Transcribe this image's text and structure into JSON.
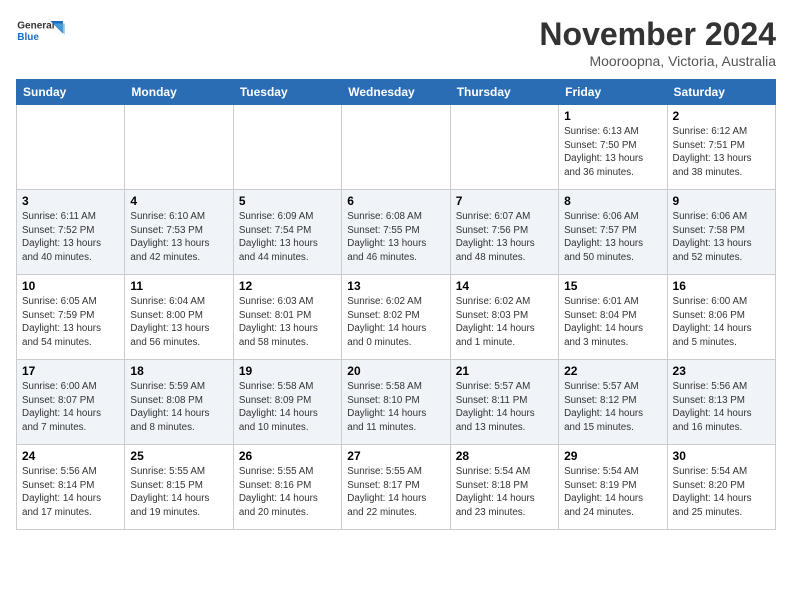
{
  "header": {
    "logo_line1": "General",
    "logo_line2": "Blue",
    "month": "November 2024",
    "location": "Mooroopna, Victoria, Australia"
  },
  "weekdays": [
    "Sunday",
    "Monday",
    "Tuesday",
    "Wednesday",
    "Thursday",
    "Friday",
    "Saturday"
  ],
  "weeks": [
    [
      {
        "day": "",
        "info": ""
      },
      {
        "day": "",
        "info": ""
      },
      {
        "day": "",
        "info": ""
      },
      {
        "day": "",
        "info": ""
      },
      {
        "day": "",
        "info": ""
      },
      {
        "day": "1",
        "info": "Sunrise: 6:13 AM\nSunset: 7:50 PM\nDaylight: 13 hours\nand 36 minutes."
      },
      {
        "day": "2",
        "info": "Sunrise: 6:12 AM\nSunset: 7:51 PM\nDaylight: 13 hours\nand 38 minutes."
      }
    ],
    [
      {
        "day": "3",
        "info": "Sunrise: 6:11 AM\nSunset: 7:52 PM\nDaylight: 13 hours\nand 40 minutes."
      },
      {
        "day": "4",
        "info": "Sunrise: 6:10 AM\nSunset: 7:53 PM\nDaylight: 13 hours\nand 42 minutes."
      },
      {
        "day": "5",
        "info": "Sunrise: 6:09 AM\nSunset: 7:54 PM\nDaylight: 13 hours\nand 44 minutes."
      },
      {
        "day": "6",
        "info": "Sunrise: 6:08 AM\nSunset: 7:55 PM\nDaylight: 13 hours\nand 46 minutes."
      },
      {
        "day": "7",
        "info": "Sunrise: 6:07 AM\nSunset: 7:56 PM\nDaylight: 13 hours\nand 48 minutes."
      },
      {
        "day": "8",
        "info": "Sunrise: 6:06 AM\nSunset: 7:57 PM\nDaylight: 13 hours\nand 50 minutes."
      },
      {
        "day": "9",
        "info": "Sunrise: 6:06 AM\nSunset: 7:58 PM\nDaylight: 13 hours\nand 52 minutes."
      }
    ],
    [
      {
        "day": "10",
        "info": "Sunrise: 6:05 AM\nSunset: 7:59 PM\nDaylight: 13 hours\nand 54 minutes."
      },
      {
        "day": "11",
        "info": "Sunrise: 6:04 AM\nSunset: 8:00 PM\nDaylight: 13 hours\nand 56 minutes."
      },
      {
        "day": "12",
        "info": "Sunrise: 6:03 AM\nSunset: 8:01 PM\nDaylight: 13 hours\nand 58 minutes."
      },
      {
        "day": "13",
        "info": "Sunrise: 6:02 AM\nSunset: 8:02 PM\nDaylight: 14 hours\nand 0 minutes."
      },
      {
        "day": "14",
        "info": "Sunrise: 6:02 AM\nSunset: 8:03 PM\nDaylight: 14 hours\nand 1 minute."
      },
      {
        "day": "15",
        "info": "Sunrise: 6:01 AM\nSunset: 8:04 PM\nDaylight: 14 hours\nand 3 minutes."
      },
      {
        "day": "16",
        "info": "Sunrise: 6:00 AM\nSunset: 8:06 PM\nDaylight: 14 hours\nand 5 minutes."
      }
    ],
    [
      {
        "day": "17",
        "info": "Sunrise: 6:00 AM\nSunset: 8:07 PM\nDaylight: 14 hours\nand 7 minutes."
      },
      {
        "day": "18",
        "info": "Sunrise: 5:59 AM\nSunset: 8:08 PM\nDaylight: 14 hours\nand 8 minutes."
      },
      {
        "day": "19",
        "info": "Sunrise: 5:58 AM\nSunset: 8:09 PM\nDaylight: 14 hours\nand 10 minutes."
      },
      {
        "day": "20",
        "info": "Sunrise: 5:58 AM\nSunset: 8:10 PM\nDaylight: 14 hours\nand 11 minutes."
      },
      {
        "day": "21",
        "info": "Sunrise: 5:57 AM\nSunset: 8:11 PM\nDaylight: 14 hours\nand 13 minutes."
      },
      {
        "day": "22",
        "info": "Sunrise: 5:57 AM\nSunset: 8:12 PM\nDaylight: 14 hours\nand 15 minutes."
      },
      {
        "day": "23",
        "info": "Sunrise: 5:56 AM\nSunset: 8:13 PM\nDaylight: 14 hours\nand 16 minutes."
      }
    ],
    [
      {
        "day": "24",
        "info": "Sunrise: 5:56 AM\nSunset: 8:14 PM\nDaylight: 14 hours\nand 17 minutes."
      },
      {
        "day": "25",
        "info": "Sunrise: 5:55 AM\nSunset: 8:15 PM\nDaylight: 14 hours\nand 19 minutes."
      },
      {
        "day": "26",
        "info": "Sunrise: 5:55 AM\nSunset: 8:16 PM\nDaylight: 14 hours\nand 20 minutes."
      },
      {
        "day": "27",
        "info": "Sunrise: 5:55 AM\nSunset: 8:17 PM\nDaylight: 14 hours\nand 22 minutes."
      },
      {
        "day": "28",
        "info": "Sunrise: 5:54 AM\nSunset: 8:18 PM\nDaylight: 14 hours\nand 23 minutes."
      },
      {
        "day": "29",
        "info": "Sunrise: 5:54 AM\nSunset: 8:19 PM\nDaylight: 14 hours\nand 24 minutes."
      },
      {
        "day": "30",
        "info": "Sunrise: 5:54 AM\nSunset: 8:20 PM\nDaylight: 14 hours\nand 25 minutes."
      }
    ]
  ]
}
